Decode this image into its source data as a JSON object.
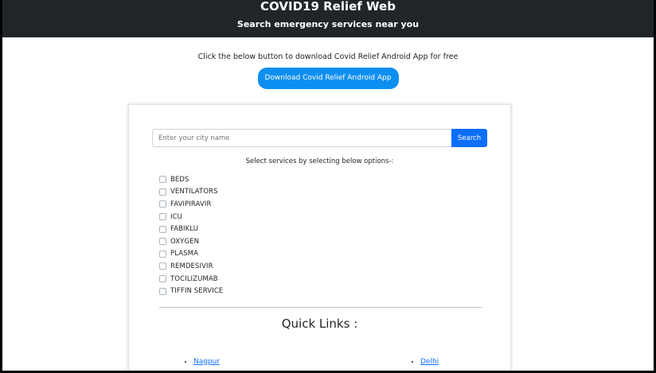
{
  "header": {
    "title": "COVID19 Relief Web",
    "subtitle": "Search emergency services near you"
  },
  "promo": {
    "text": "Click the below button to download Covid Relief Android App for free",
    "button_label": "Download Covid Relief Android App"
  },
  "search": {
    "placeholder": "Enter your city name",
    "value": "",
    "button_label": "Search"
  },
  "services": {
    "label": "Select services by selecting below options-:",
    "options": [
      "BEDS",
      "VENTILATORS",
      "FAVIPIRAVIR",
      "ICU",
      "FABIKLU",
      "OXYGEN",
      "PLASMA",
      "REMDESIVIR",
      "TOCILIZUMAB",
      "TIFFIN SERVICE"
    ]
  },
  "quick_links": {
    "title": "Quick Links :",
    "left": [
      "Nagpur"
    ],
    "right": [
      "Delhi"
    ]
  }
}
